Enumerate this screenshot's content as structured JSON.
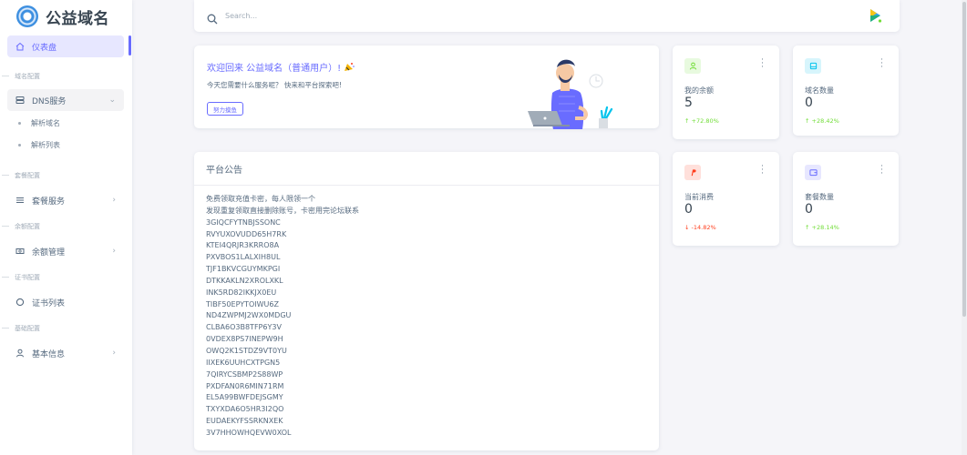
{
  "brand": {
    "name": "公益域名"
  },
  "sidebar": {
    "dashboard": "仪表盘",
    "sections": {
      "domain": "域名配置",
      "package": "套餐配置",
      "balance": "余额配置",
      "cert": "证书配置",
      "basic": "基础配置"
    },
    "dns_service": "DNS服务",
    "dns_sub": [
      "解析域名",
      "解析列表"
    ],
    "package_service": "套餐服务",
    "balance_manage": "余额管理",
    "cert_list": "证书列表",
    "basic_info": "基本信息"
  },
  "search": {
    "placeholder": "Search..."
  },
  "welcome": {
    "title": "欢迎回来 公益域名（普通用户）!",
    "subtitle": "今天您需要什么服务呢？ 快来和平台探索吧!",
    "button": "努力摸鱼"
  },
  "stats": [
    {
      "label": "我的余额",
      "value": "5",
      "change": "+72.80%",
      "trend": "up",
      "icon": "user-icon",
      "color": "#71dd37",
      "bg": "#e8fadf"
    },
    {
      "label": "域名数量",
      "value": "0",
      "change": "+28.42%",
      "trend": "up",
      "icon": "storage-icon",
      "color": "#03c3ec",
      "bg": "#d7f5fc"
    },
    {
      "label": "当前消费",
      "value": "0",
      "change": "-14.82%",
      "trend": "down",
      "icon": "paypal-icon",
      "color": "#ff3e1d",
      "bg": "#ffe0db"
    },
    {
      "label": "套餐数量",
      "value": "0",
      "change": "+28.14%",
      "trend": "up",
      "icon": "wallet-icon",
      "color": "#696cff",
      "bg": "#e7e7ff"
    }
  ],
  "notice": {
    "title": "平台公告",
    "lines": [
      "免费领取充值卡密，每人限领一个",
      "发现重复领取直接删除账号，卡密用完论坛联系",
      "3GIQCFYTNBJSSONC",
      "RVYUXOVUDD65H7RK",
      "KTEI4QRJR3KRRO8A",
      "PXVBOS1LALXIH8UL",
      "TJF1BKVCGUYMKPGI",
      "DTKKAKLN2XROLXKL",
      "INK5RD82IKKJX0EU",
      "TIBF50EPYTOIWU6Z",
      "ND4ZWPMJ2WX0MDGU",
      "CLBA6O3B8TFP6Y3V",
      "0VDEX8PS7INEPW9H",
      "OWQ2K1STDZ9VT0YU",
      "IIXEK6UUHCXTPGN5",
      "7QIRYCSBMP2S88WP",
      "PXDFAN0R6MIN71RM",
      "EL5A99BWFDEJSGMY",
      "TXYXDA6O5HR3I2QO",
      "EUDAEKYFSSRKNXEK",
      "3V7HHOWHQEVW0XOL"
    ]
  },
  "colors": {
    "primary": "#696cff",
    "success": "#71dd37",
    "danger": "#ff3e1d",
    "info": "#03c3ec"
  }
}
